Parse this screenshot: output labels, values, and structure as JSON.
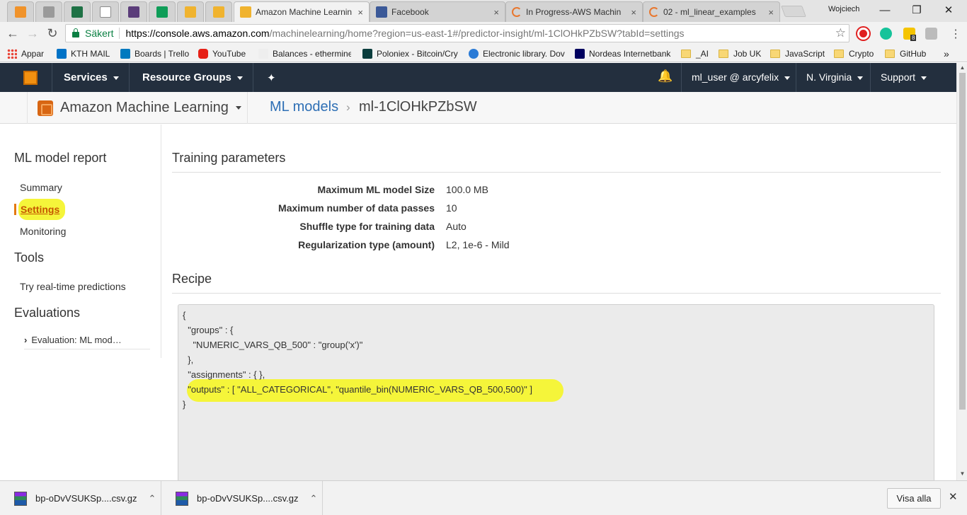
{
  "browser": {
    "pinned_tabs": [
      {
        "icon": "aws-smile-icon",
        "color": "#f0932b"
      },
      {
        "icon": "puzzle-icon",
        "color": "#9a9a9a"
      },
      {
        "icon": "spreadsheet-icon",
        "color": "#1e7145"
      },
      {
        "icon": "document-icon",
        "color": "#8c8c8c"
      },
      {
        "icon": "w-icon",
        "color": "#5b3d7a"
      },
      {
        "icon": "sheets-icon",
        "color": "#0f9d58"
      },
      {
        "icon": "aws-cube-icon",
        "color": "#f0b32f"
      },
      {
        "icon": "aws-cube-icon",
        "color": "#f0b32f"
      }
    ],
    "tabs": [
      {
        "title": "Amazon Machine Learnin",
        "close": "×"
      },
      {
        "title": "Facebook",
        "close": "×"
      },
      {
        "title": "In Progress-AWS Machin",
        "close": "×"
      },
      {
        "title": "02 - ml_linear_examples",
        "close": "×"
      }
    ],
    "profile_name": "Wojciech",
    "window_controls": {
      "minimize": "—",
      "maximize": "❐",
      "close": "✕"
    },
    "nav": {
      "back": "←",
      "forward": "→",
      "reload": "↻"
    },
    "secure_label": "Säkert",
    "url_host": "https://console.aws.amazon.com",
    "url_rest": "/machinelearning/home?region=us-east-1#/predictor-insight/ml-1ClOHkPZbSW?tabId=settings",
    "star": "☆",
    "ext_badge": "8"
  },
  "bookmarks": [
    {
      "label": "Appar",
      "kind": "apps"
    },
    {
      "label": "KTH MAIL",
      "kind": "outlook"
    },
    {
      "label": "Boards | Trello",
      "kind": "trello"
    },
    {
      "label": "YouTube",
      "kind": "youtube"
    },
    {
      "label": "Balances - ethermine",
      "kind": "miner"
    },
    {
      "label": "Poloniex - Bitcoin/Cry",
      "kind": "poloniex"
    },
    {
      "label": "Electronic library. Dov",
      "kind": "globe"
    },
    {
      "label": "Nordeas Internetbank",
      "kind": "nordea"
    },
    {
      "label": "_AI",
      "kind": "folder"
    },
    {
      "label": "Job UK",
      "kind": "folder"
    },
    {
      "label": "JavaScript",
      "kind": "folder"
    },
    {
      "label": "Crypto",
      "kind": "folder"
    },
    {
      "label": "GitHub",
      "kind": "folder"
    }
  ],
  "bookmarks_more": "»",
  "aws_nav": {
    "services": "Services",
    "resource_groups": "Resource Groups",
    "pin": "✦",
    "bell": "🔔",
    "account": "ml_user @ arcyfelix",
    "region": "N. Virginia",
    "support": "Support"
  },
  "subheader": {
    "service_name": "Amazon Machine Learning",
    "crumb_link": "ML models",
    "crumb_sep": "›",
    "crumb_current": "ml-1ClOHkPZbSW"
  },
  "leftnav": {
    "report_heading": "ML model report",
    "summary": "Summary",
    "settings": "Settings",
    "monitoring": "Monitoring",
    "tools_heading": "Tools",
    "realtime": "Try real-time predictions",
    "evaluations_heading": "Evaluations",
    "evaluation_item": "Evaluation: ML mod…",
    "chevron": "›"
  },
  "training": {
    "title": "Training parameters",
    "params": [
      {
        "label": "Maximum ML model Size",
        "value": "100.0 MB"
      },
      {
        "label": "Maximum number of data passes",
        "value": "10"
      },
      {
        "label": "Shuffle type for training data",
        "value": "Auto"
      },
      {
        "label": "Regularization type (amount)",
        "value": "L2, 1e-6 - Mild"
      }
    ]
  },
  "recipe": {
    "title": "Recipe",
    "lines": [
      "{",
      "  \"groups\" : {",
      "    \"NUMERIC_VARS_QB_500\" : \"group('x')\"",
      "  },",
      "  \"assignments\" : { },",
      "  \"outputs\" : [ \"ALL_CATEGORICAL\", \"quantile_bin(NUMERIC_VARS_QB_500,500)\" ]",
      "}"
    ]
  },
  "downloads": {
    "items": [
      {
        "file": "bp-oDvVSUKSp....csv.gz",
        "chevron": "⌃"
      },
      {
        "file": "bp-oDvVSUKSp....csv.gz",
        "chevron": "⌃"
      }
    ],
    "show_all": "Visa alla",
    "close": "✕"
  },
  "colors": {
    "aws_header": "#232f3e",
    "highlight": "#f5f53a",
    "link": "#2e6fb5",
    "active_nav": "#c45500"
  }
}
